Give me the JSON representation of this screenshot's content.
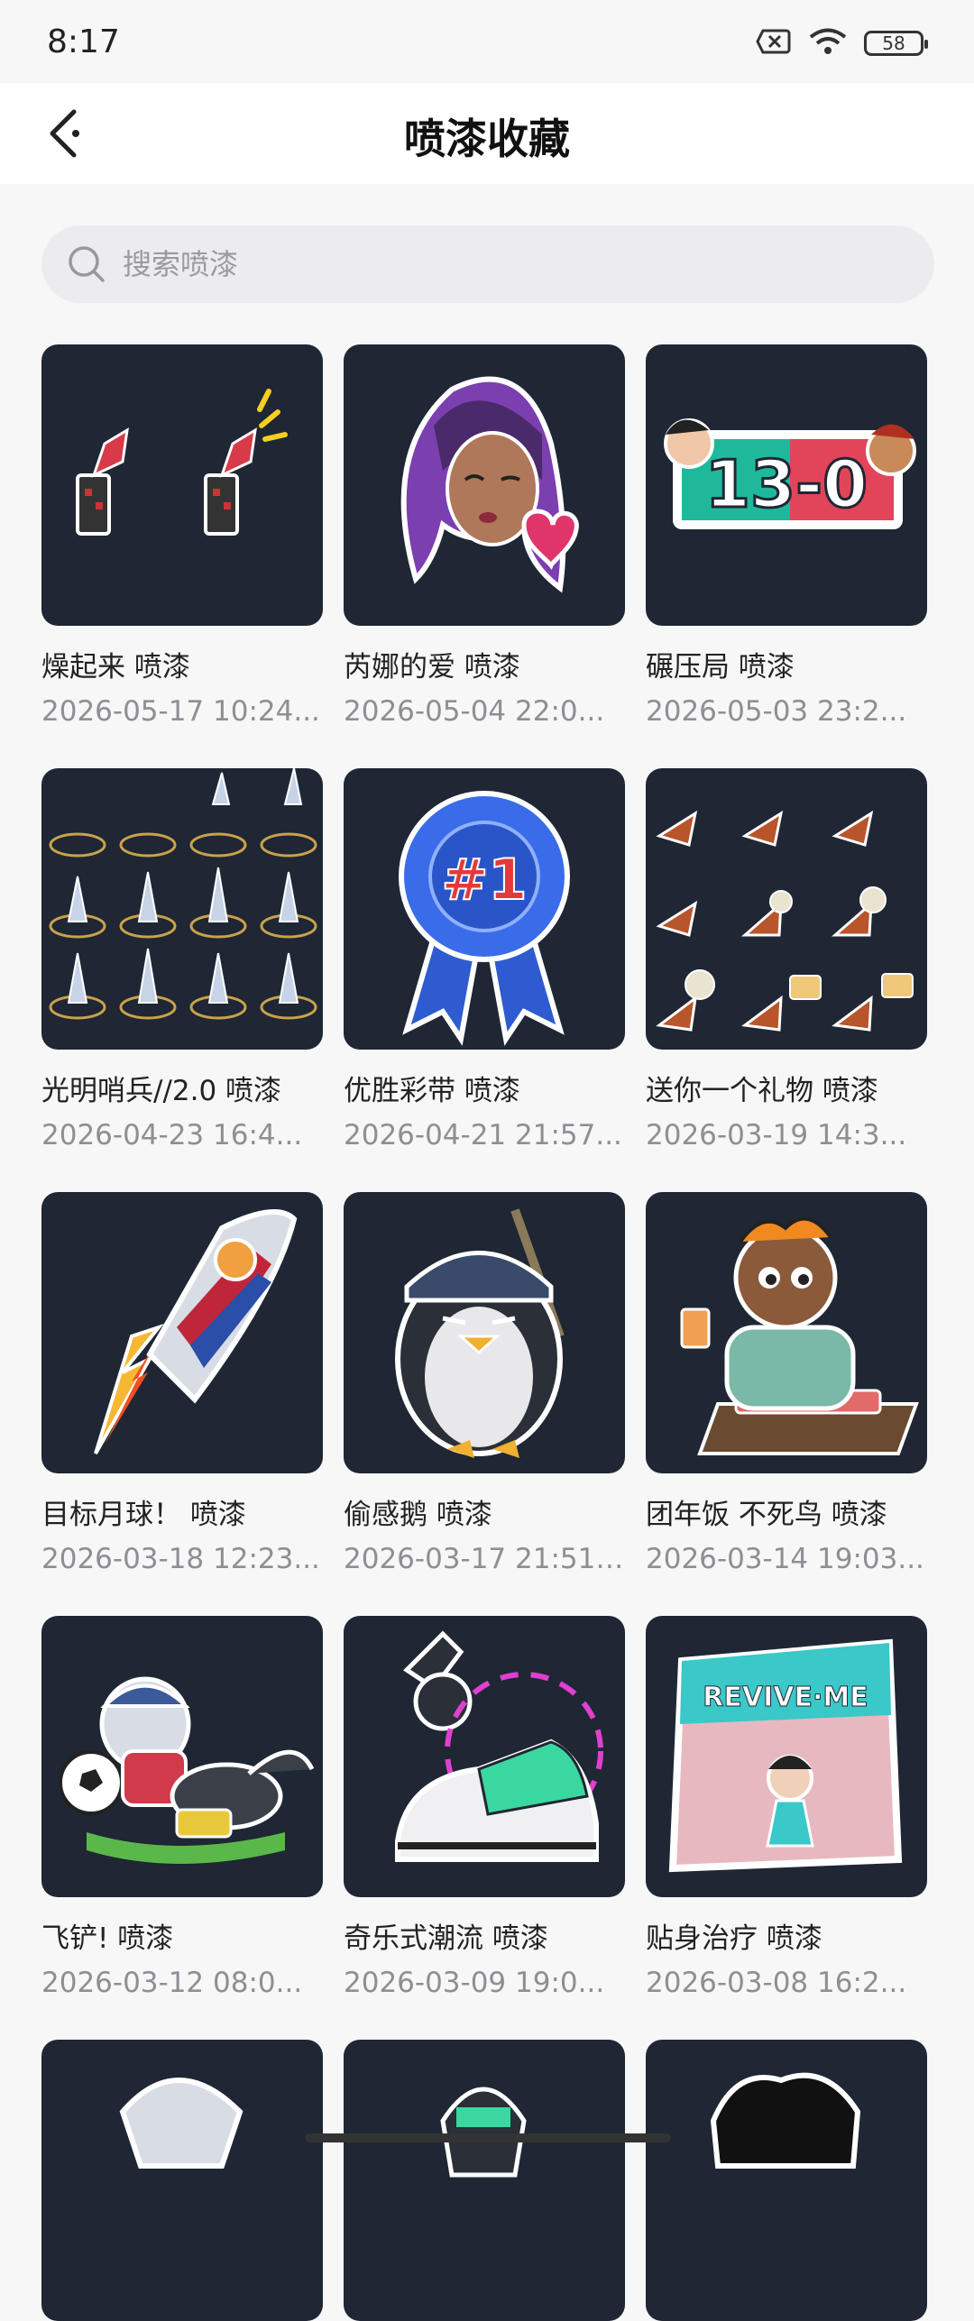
{
  "status": {
    "time": "8:17",
    "battery": "58"
  },
  "header": {
    "title": "喷漆收藏"
  },
  "search": {
    "placeholder": "搜索喷漆"
  },
  "items": [
    {
      "name": "燥起来 喷漆",
      "date": "2026-05-17 10:24..."
    },
    {
      "name": "芮娜的爱 喷漆",
      "date": "2026-05-04 22:0..."
    },
    {
      "name": "碾压局 喷漆",
      "date": "2026-05-03 23:2..."
    },
    {
      "name": "光明哨兵//2.0 喷漆",
      "date": "2026-04-23 16:4..."
    },
    {
      "name": "优胜彩带 喷漆",
      "date": "2026-04-21 21:57..."
    },
    {
      "name": "送你一个礼物 喷漆",
      "date": "2026-03-19 14:3..."
    },
    {
      "name": "目标月球！ 喷漆",
      "date": "2026-03-18 12:23..."
    },
    {
      "name": "偷感鹅 喷漆",
      "date": "2026-03-17 21:51:..."
    },
    {
      "name": "团年饭 不死鸟 喷漆",
      "date": "2026-03-14 19:03..."
    },
    {
      "name": "飞铲! 喷漆",
      "date": "2026-03-12 08:0..."
    },
    {
      "name": "奇乐式潮流 喷漆",
      "date": "2026-03-09 19:0..."
    },
    {
      "name": "贴身治疗 喷漆",
      "date": "2026-03-08 16:2..."
    },
    {
      "name": "",
      "date": ""
    },
    {
      "name": "",
      "date": ""
    },
    {
      "name": "",
      "date": ""
    }
  ],
  "art_text": {
    "score": "13-0",
    "rank": "#1",
    "revive": "REVIVE·ME"
  }
}
